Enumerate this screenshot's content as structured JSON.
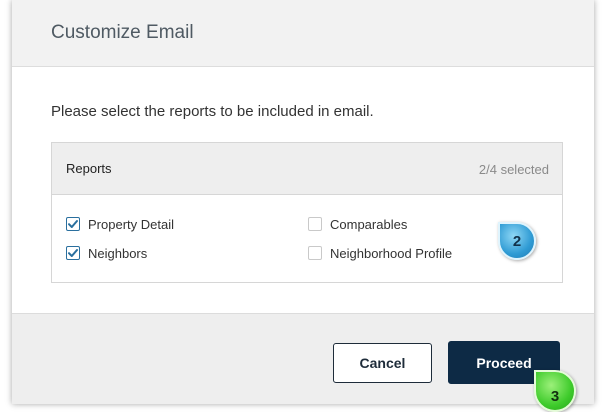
{
  "dialog": {
    "title": "Customize Email",
    "instruction": "Please select the reports to be included in email."
  },
  "reports": {
    "title": "Reports",
    "count": "2/4 selected",
    "options": [
      {
        "label": "Property Detail",
        "checked": true
      },
      {
        "label": "Neighbors",
        "checked": true
      },
      {
        "label": "Comparables",
        "checked": false
      },
      {
        "label": "Neighborhood Profile",
        "checked": false
      }
    ]
  },
  "footer": {
    "cancel_label": "Cancel",
    "proceed_label": "Proceed"
  },
  "steps": {
    "reports_step": "2",
    "proceed_step": "3"
  },
  "colors": {
    "primary": "#0d2a45",
    "checkbox_accent": "#2a6f9e"
  },
  "icons": {
    "checked": "check-icon"
  }
}
